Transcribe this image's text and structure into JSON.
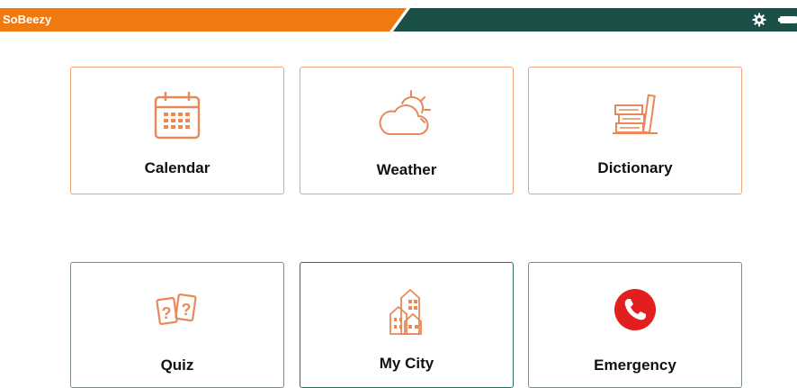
{
  "app": {
    "title": "SoBeezy"
  },
  "colors": {
    "orange": "#f07a10",
    "teal": "#1b5048",
    "tile_icon": "#e8895a",
    "emergency": "#e31e1e"
  },
  "header_icons": {
    "settings": "gear-icon",
    "battery": "battery-icon"
  },
  "tiles": [
    {
      "label": "Calendar",
      "icon": "calendar-icon"
    },
    {
      "label": "Weather",
      "icon": "weather-icon"
    },
    {
      "label": "Dictionary",
      "icon": "books-icon"
    },
    {
      "label": "Quiz",
      "icon": "question-cards-icon"
    },
    {
      "label": "My City",
      "icon": "city-buildings-icon"
    },
    {
      "label": "Emergency",
      "icon": "phone-icon"
    }
  ]
}
